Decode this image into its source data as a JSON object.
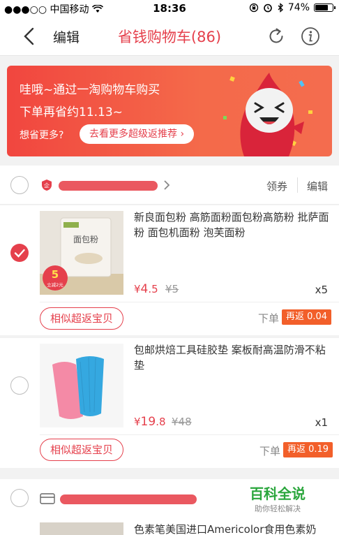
{
  "status": {
    "carrier": "●●●○○ 中国移动",
    "time": "18:36",
    "battery": "74%",
    "battery_level": 0.74
  },
  "nav": {
    "edit": "编辑",
    "title": "省钱购物车(86)"
  },
  "banner": {
    "line1": "哇哦~通过一淘购物车购买",
    "line2": "下单再省约11.13~",
    "ask": "想省更多?",
    "button": "去看更多超级返推荐 ›"
  },
  "shop": {
    "coupon": "领券",
    "edit": "编辑"
  },
  "items": [
    {
      "title": "新良面包粉 高筋面粉面包粉高筋粉 批萨面粉 面包机面粉 泡芙面粉",
      "price_symbol": "¥",
      "price_int": "4",
      "price_dec": ".5",
      "old_price": "¥5",
      "qty": "x5",
      "similar": "相似超返宝贝",
      "order": "下单",
      "rebate": "再返 0.04",
      "img_label": "面包粉",
      "promo_num": "5",
      "promo_text": "立减2元",
      "checked": true
    },
    {
      "title": "包邮烘焙工具硅胶垫 案板耐高温防滑不粘垫",
      "price_symbol": "¥",
      "price_int": "19",
      "price_dec": ".8",
      "old_price": "¥48",
      "qty": "x1",
      "similar": "相似超返宝贝",
      "order": "下单",
      "rebate": "再返 0.19",
      "checked": false
    }
  ],
  "item3": {
    "title": "色素笔美国进口Americolor食用色素奶"
  },
  "watermark": {
    "title": "百科全说",
    "sub": "助你轻松解决"
  },
  "colors": {
    "accent": "#e5404c",
    "rebate": "#f25f2a",
    "watermark": "#2aa63c"
  }
}
